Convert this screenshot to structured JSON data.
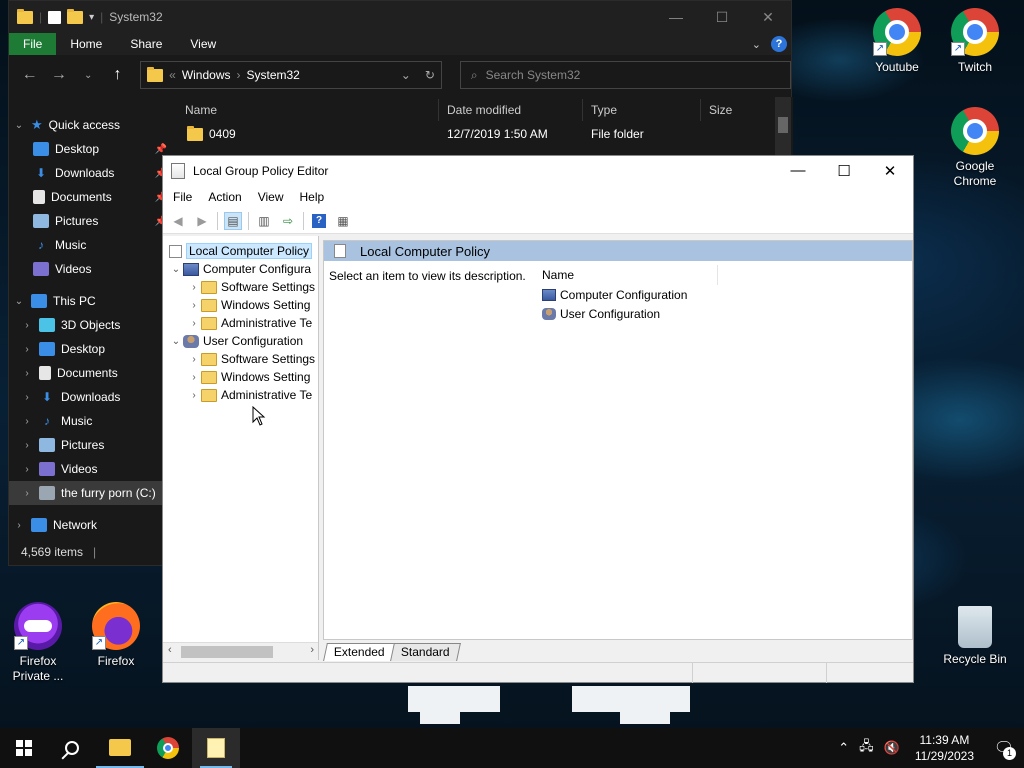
{
  "explorer": {
    "title": "System32",
    "ribbon_tabs": [
      "File",
      "Home",
      "Share",
      "View"
    ],
    "path": [
      "Windows",
      "System32"
    ],
    "path_prefix": "«",
    "search_placeholder": "Search System32",
    "columns": [
      "Name",
      "Date modified",
      "Type",
      "Size"
    ],
    "rows": [
      {
        "name": "0409",
        "date": "12/7/2019 1:50 AM",
        "type": "File folder"
      }
    ],
    "sidebar": {
      "quick_access": "Quick access",
      "quick_items": [
        "Desktop",
        "Downloads",
        "Documents",
        "Pictures",
        "Music",
        "Videos"
      ],
      "this_pc": "This PC",
      "pc_items": [
        "3D Objects",
        "Desktop",
        "Documents",
        "Downloads",
        "Music",
        "Pictures",
        "Videos",
        "the furry porn (C:)"
      ],
      "network": "Network"
    },
    "status": "4,569 items"
  },
  "gpe": {
    "title": "Local Group Policy Editor",
    "menu": [
      "File",
      "Action",
      "View",
      "Help"
    ],
    "tree": {
      "root": "Local Computer Policy",
      "computer": "Computer Configura",
      "computer_children": [
        "Software Settings",
        "Windows Setting",
        "Administrative Te"
      ],
      "user": "User Configuration",
      "user_children": [
        "Software Settings",
        "Windows Setting",
        "Administrative Te"
      ]
    },
    "pane_header": "Local Computer Policy",
    "description": "Select an item to view its description.",
    "list_header": "Name",
    "list_items": [
      "Computer Configuration",
      "User Configuration"
    ],
    "tabs": [
      "Extended",
      "Standard"
    ]
  },
  "desktop_icons": {
    "youtube": "Youtube",
    "twitch": "Twitch",
    "chrome": "Google Chrome",
    "ff_private": "Firefox Private ...",
    "firefox": "Firefox",
    "recycle": "Recycle Bin"
  },
  "taskbar": {
    "time": "11:39 AM",
    "date": "11/29/2023",
    "notification_count": "1"
  },
  "colors": {
    "file_tab": "#1e7b36",
    "pane_header": "#a8c2df",
    "selection": "#cce8ff"
  }
}
